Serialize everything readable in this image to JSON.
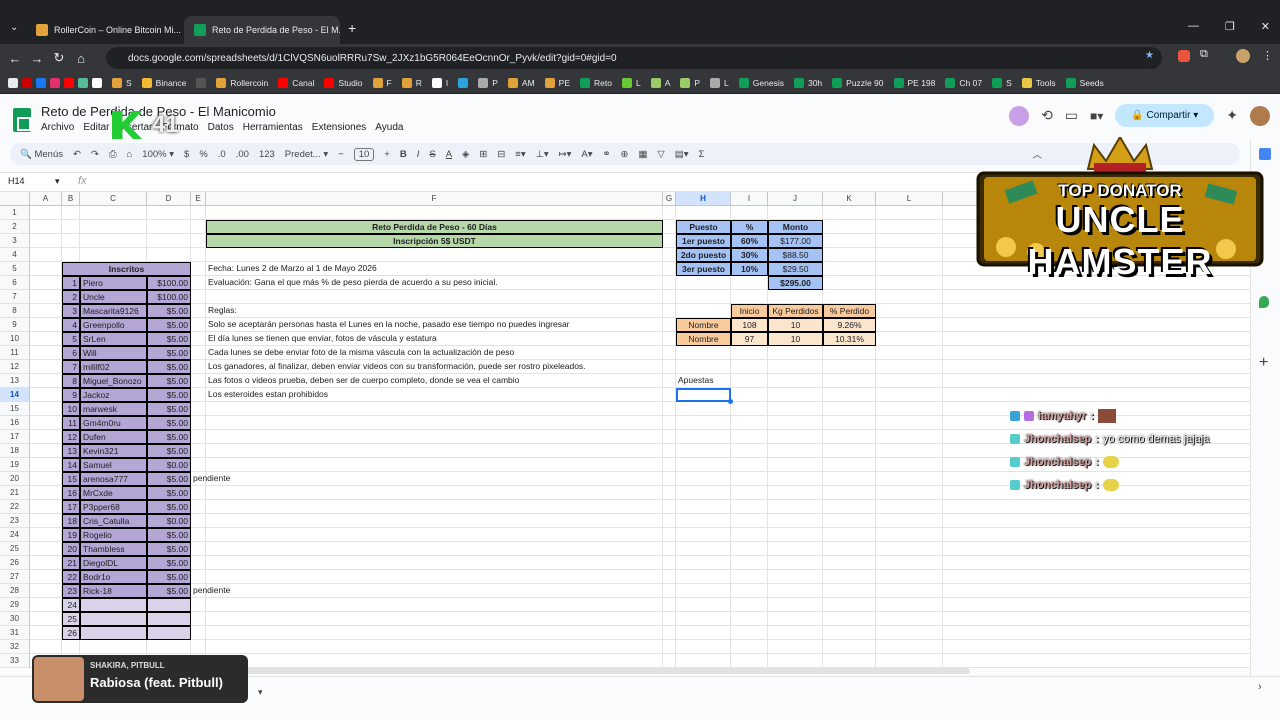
{
  "browser": {
    "tabs": [
      {
        "title": "RollerCoin – Online Bitcoin Mi...",
        "active": false,
        "favicon_color": "#e2a23a"
      },
      {
        "title": "Reto de Perdida de Peso - El M...",
        "active": true,
        "favicon_color": "#0f9d58"
      }
    ],
    "url": "docs.google.com/spreadsheets/d/1ClVQSN6uolRRRu7Sw_2JXz1bG5R064EeOcnnOr_Pyvk/edit?gid=0#gid=0",
    "bookmarks": [
      "S",
      "Binance",
      "Rollercoin",
      "Canal",
      "Studio",
      "F",
      "R",
      "I",
      "P",
      "AM",
      "PE",
      "Reto",
      "L",
      "A",
      "P",
      "L",
      "Genesis",
      "30h",
      "Puzzle 90",
      "PE 198",
      "Ch 07",
      "S",
      "Tools",
      "Seeds"
    ]
  },
  "sheets": {
    "title": "Reto de Perdida de Peso - El Manicomio",
    "menu": [
      "Archivo",
      "Editar",
      "Insertar",
      "Formato",
      "Datos",
      "Herramientas",
      "Extensiones",
      "Ayuda"
    ],
    "share_label": "Compartir",
    "toolbar": {
      "search": "Menús",
      "zoom": "100%",
      "currency": "$",
      "percent": "%",
      "dec_minus": ".0",
      "dec_plus": ".00",
      "num": "123",
      "font": "Predet...",
      "fontsize": "10"
    },
    "namebox": "H14",
    "fx": "fx",
    "columns": [
      "A",
      "B",
      "C",
      "D",
      "E",
      "F",
      "G",
      "H",
      "I",
      "J",
      "K",
      "L"
    ],
    "rows": [
      "1",
      "2",
      "3",
      "4",
      "5",
      "6",
      "7",
      "8",
      "9",
      "10",
      "11",
      "12",
      "13",
      "14",
      "15",
      "16",
      "17",
      "18",
      "19",
      "20",
      "21",
      "22",
      "23",
      "24",
      "25",
      "26",
      "27",
      "28",
      "29",
      "30",
      "31",
      "32",
      "33"
    ],
    "title_main": "Reto Perdida de Peso - 60 Días",
    "title_sub": "Inscripción 5$ USDT",
    "inscritos_header": "Inscritos",
    "participants": [
      {
        "n": "1",
        "name": "Piero",
        "amt": "$100.00"
      },
      {
        "n": "2",
        "name": "Uncle",
        "amt": "$100.00"
      },
      {
        "n": "3",
        "name": "Mascarita9126",
        "amt": "$5.00"
      },
      {
        "n": "4",
        "name": "Greenpollo",
        "amt": "$5.00"
      },
      {
        "n": "5",
        "name": "SrLen",
        "amt": "$5.00"
      },
      {
        "n": "6",
        "name": "Will",
        "amt": "$5.00"
      },
      {
        "n": "7",
        "name": "mililf02",
        "amt": "$5.00"
      },
      {
        "n": "8",
        "name": "Miguel_Bonozo",
        "amt": "$5.00"
      },
      {
        "n": "9",
        "name": "Jackoz",
        "amt": "$5.00"
      },
      {
        "n": "10",
        "name": "marwesk",
        "amt": "$5.00"
      },
      {
        "n": "11",
        "name": "Gm4m0ru",
        "amt": "$5.00"
      },
      {
        "n": "12",
        "name": "Dufen",
        "amt": "$5.00"
      },
      {
        "n": "13",
        "name": "Kevin321",
        "amt": "$5.00"
      },
      {
        "n": "14",
        "name": "Samuel",
        "amt": "$0.00"
      },
      {
        "n": "15",
        "name": "arenosa777",
        "amt": "$5.00"
      },
      {
        "n": "16",
        "name": "MrCxde",
        "amt": "$5.00"
      },
      {
        "n": "17",
        "name": "P3pper68",
        "amt": "$5.00"
      },
      {
        "n": "18",
        "name": "Cris_Catulla",
        "amt": "$0.00"
      },
      {
        "n": "19",
        "name": "Rogelio",
        "amt": "$5.00"
      },
      {
        "n": "20",
        "name": "Thambless",
        "amt": "$5.00"
      },
      {
        "n": "21",
        "name": "DiegolDL",
        "amt": "$5.00"
      },
      {
        "n": "22",
        "name": "Bodr1o",
        "amt": "$5.00"
      },
      {
        "n": "23",
        "name": "Rick-18",
        "amt": "$5.00"
      },
      {
        "n": "24",
        "name": "",
        "amt": ""
      },
      {
        "n": "25",
        "name": "",
        "amt": ""
      },
      {
        "n": "26",
        "name": "",
        "amt": ""
      }
    ],
    "pendiente": "pendiente",
    "info": [
      "Fecha: Lunes 2 de Marzo al 1 de Mayo 2026",
      "Evaluación: Gana el que más % de peso pierda de acuerdo a su peso inicial.",
      "",
      "Reglas:",
      "Solo se aceptarán personas hasta el Lunes en la noche, pasado ese tiempo no puedes ingresar",
      "El día lunes se tienen que enviar, fotos de váscula y estatura",
      "Cada lunes se debe enviar foto de la misma váscula con la actualización de peso",
      "Los ganadores, al finalizar, deben enviar videos con su transformación, puede ser rostro pixeleados.",
      "Las fotos o videos prueba, deben ser de cuerpo completo, donde se vea el cambio",
      "Los esteroides estan prohibidos"
    ],
    "prizes": {
      "headers": [
        "Puesto",
        "%",
        "Monto"
      ],
      "rows": [
        [
          "1er puesto",
          "60%",
          "$177.00"
        ],
        [
          "2do puesto",
          "30%",
          "$88.50"
        ],
        [
          "3er puesto",
          "10%",
          "$29.50"
        ]
      ],
      "total": "$295.00"
    },
    "weights": {
      "headers": [
        "Inicio",
        "Kg Perdidos",
        "% Perdido"
      ],
      "rows": [
        [
          "Nombre",
          "108",
          "10",
          "9.26%"
        ],
        [
          "Nombre",
          "97",
          "10",
          "10.31%"
        ]
      ]
    },
    "apuestas": "Apuestas"
  },
  "overlay": {
    "donator_top": "TOP DONATOR",
    "donator_name": "UNCLE HAMSTER",
    "counter": "41",
    "chat": [
      {
        "user": "iamyahyr",
        "msg": ""
      },
      {
        "user": "Jhonchalsep",
        "msg": "yo como demas jajaja"
      },
      {
        "user": "Jhonchalsep",
        "msg": ""
      },
      {
        "user": "Jhonchalsep",
        "msg": ""
      }
    ],
    "music_artist": "SHAKIRA, PITBULL",
    "music_title": "Rabiosa (feat. Pitbull)"
  }
}
